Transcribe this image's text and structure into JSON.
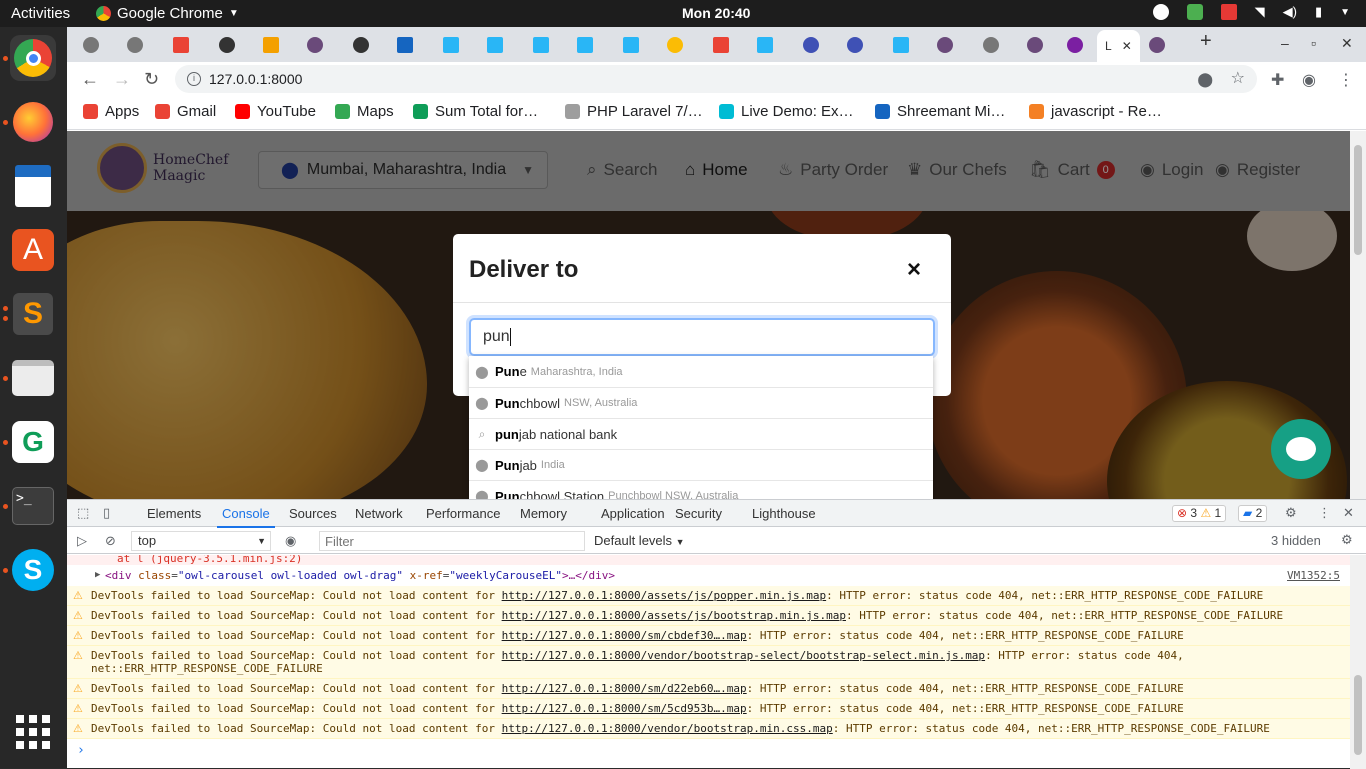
{
  "system": {
    "activities": "Activities",
    "app_name": "Google Chrome",
    "clock": "Mon 20:40"
  },
  "dock": [
    "chrome-icon",
    "firefox-icon",
    "writer-icon",
    "app-center-icon",
    "sublime-icon",
    "files-icon",
    "chat-app-icon",
    "terminal-icon",
    "skype-icon",
    "app-grid-icon"
  ],
  "browser": {
    "active_tab_title": "L",
    "url": "127.0.0.1:8000",
    "bookmarks": [
      {
        "label": "Apps",
        "color": "#ea4335"
      },
      {
        "label": "Gmail",
        "color": "#ea4335"
      },
      {
        "label": "YouTube",
        "color": "#ff0000"
      },
      {
        "label": "Maps",
        "color": "#34a853"
      },
      {
        "label": "Sum Total for…",
        "color": "#0f9d58"
      },
      {
        "label": "PHP Laravel 7/…",
        "color": "#9e9e9e"
      },
      {
        "label": "Live Demo: Ex…",
        "color": "#00bcd4"
      },
      {
        "label": "Shreemant Mi…",
        "color": "#1565c0"
      },
      {
        "label": "javascript - Re…",
        "color": "#f48024"
      }
    ]
  },
  "site": {
    "brand_line1": "HomeChef",
    "brand_line2": "Maagic",
    "location": "Mumbai, Maharashtra, India",
    "nav": {
      "search": "Search",
      "home": "Home",
      "party_order": "Party Order",
      "our_chefs": "Our Chefs",
      "cart": "Cart",
      "cart_count": "0",
      "login": "Login",
      "register": "Register"
    }
  },
  "modal": {
    "title": "Deliver to",
    "close": "×",
    "search_value": "pun",
    "suggestions": [
      {
        "match": "Pun",
        "rest": "e",
        "secondary": "Maharashtra, India",
        "icon": "pin"
      },
      {
        "match": "Pun",
        "rest": "chbowl",
        "secondary": "NSW, Australia",
        "icon": "pin"
      },
      {
        "match": "pun",
        "rest": "jab national bank",
        "secondary": "",
        "icon": "search"
      },
      {
        "match": "Pun",
        "rest": "jab",
        "secondary": "India",
        "icon": "pin"
      },
      {
        "match": "Pun",
        "rest": "chbowl Station",
        "secondary": "Punchbowl NSW, Australia",
        "icon": "pin"
      }
    ]
  },
  "devtools": {
    "tabs": [
      "Elements",
      "Console",
      "Sources",
      "Network",
      "Performance",
      "Memory",
      "Application",
      "Security",
      "Lighthouse"
    ],
    "active_tab": "Console",
    "errors": "3",
    "warnings": "1",
    "messages": "2",
    "context": "top",
    "filter_placeholder": "Filter",
    "levels": "Default levels",
    "hidden": "3 hidden",
    "error_tail": "at l (jquery-3.5.1.min.js:2)",
    "node_line": {
      "open": "<div",
      "class_attr": "class",
      "class_val": "\"owl-carousel owl-loaded owl-drag\"",
      "xref_attr": "x-ref",
      "xref_val": "\"weeklyCarouseEL\"",
      "close": ">…</div>",
      "source": "VM1352:5"
    },
    "warnings_list": [
      {
        "prefix": "DevTools failed to load SourceMap: Could not load content for ",
        "url": "http://127.0.0.1:8000/assets/js/popper.min.js.map",
        "suffix": ": HTTP error: status code 404, net::ERR_HTTP_RESPONSE_CODE_FAILURE"
      },
      {
        "prefix": "DevTools failed to load SourceMap: Could not load content for ",
        "url": "http://127.0.0.1:8000/assets/js/bootstrap.min.js.map",
        "suffix": ": HTTP error: status code 404, net::ERR_HTTP_RESPONSE_CODE_FAILURE"
      },
      {
        "prefix": "DevTools failed to load SourceMap: Could not load content for ",
        "url": "http://127.0.0.1:8000/sm/cbdef30….map",
        "suffix": ": HTTP error: status code 404, net::ERR_HTTP_RESPONSE_CODE_FAILURE"
      },
      {
        "prefix": "DevTools failed to load SourceMap: Could not load content for ",
        "url": "http://127.0.0.1:8000/vendor/bootstrap-select/bootstrap-select.min.js.map",
        "suffix": ": HTTP error: status code 404, net::ERR_HTTP_RESPONSE_CODE_FAILURE"
      },
      {
        "prefix": "DevTools failed to load SourceMap: Could not load content for ",
        "url": "http://127.0.0.1:8000/sm/d22eb60….map",
        "suffix": ": HTTP error: status code 404, net::ERR_HTTP_RESPONSE_CODE_FAILURE"
      },
      {
        "prefix": "DevTools failed to load SourceMap: Could not load content for ",
        "url": "http://127.0.0.1:8000/sm/5cd953b….map",
        "suffix": ": HTTP error: status code 404, net::ERR_HTTP_RESPONSE_CODE_FAILURE"
      },
      {
        "prefix": "DevTools failed to load SourceMap: Could not load content for ",
        "url": "http://127.0.0.1:8000/vendor/bootstrap.min.css.map",
        "suffix": ": HTTP error: status code 404, net::ERR_HTTP_RESPONSE_CODE_FAILURE"
      }
    ]
  }
}
